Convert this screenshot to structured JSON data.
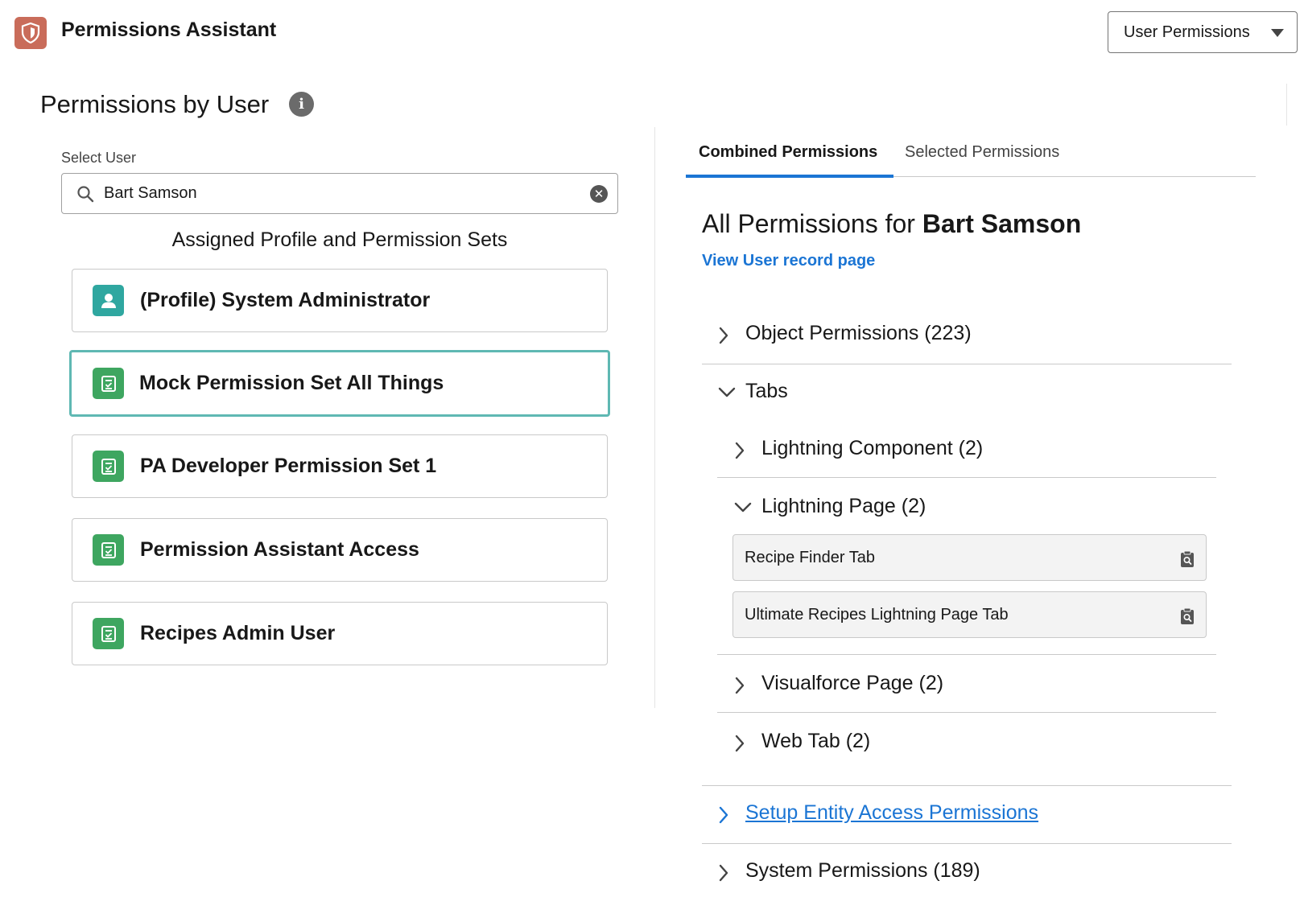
{
  "header": {
    "app_title": "Permissions Assistant",
    "view_select_value": "User Permissions"
  },
  "page": {
    "title": "Permissions by User"
  },
  "user_select": {
    "label": "Select User",
    "value": "Bart Samson"
  },
  "assigned": {
    "heading": "Assigned Profile and Permission Sets",
    "items": [
      {
        "label": "(Profile) System Administrator",
        "icon": "user-profile-icon",
        "selected": false
      },
      {
        "label": "Mock Permission Set All Things",
        "icon": "permission-set-icon",
        "selected": true
      },
      {
        "label": "PA Developer Permission Set 1",
        "icon": "permission-set-icon",
        "selected": false
      },
      {
        "label": "Permission Assistant Access",
        "icon": "permission-set-icon",
        "selected": false
      },
      {
        "label": "Recipes Admin User",
        "icon": "permission-set-icon",
        "selected": false
      }
    ]
  },
  "tabs": {
    "combined": "Combined Permissions",
    "selected": "Selected Permissions",
    "active": "combined"
  },
  "details": {
    "prefix": "All Permissions for ",
    "user_name": "Bart Samson",
    "record_link": "View User record page",
    "sections": {
      "object_permissions": "Object Permissions (223)",
      "tabs": "Tabs",
      "lightning_component": "Lightning Component (2)",
      "lightning_page": "Lightning Page (2)",
      "lightning_page_items": [
        "Recipe Finder Tab",
        "Ultimate Recipes Lightning Page Tab"
      ],
      "visualforce_page": "Visualforce Page (2)",
      "web_tab": "Web Tab (2)",
      "setup_entity": "Setup Entity Access Permissions",
      "system_permissions": "System Permissions (189)"
    }
  },
  "colors": {
    "accent": "#1b75d4",
    "selected_border": "#5fb8b3",
    "profile_icon": "#2fa7a0",
    "permset_icon": "#3ea660",
    "app_icon": "#c96c5a"
  }
}
